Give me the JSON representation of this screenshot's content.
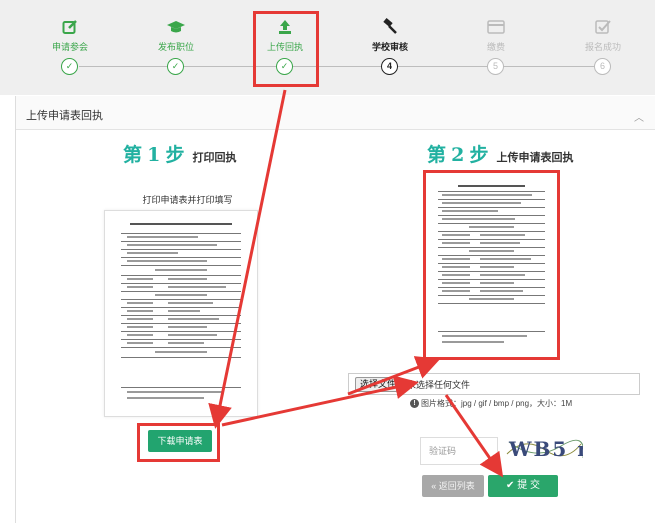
{
  "stepper": {
    "steps": [
      {
        "label": "申请参会",
        "num": "1",
        "state": "done",
        "icon": "edit-icon"
      },
      {
        "label": "发布职位",
        "num": "2",
        "state": "done",
        "icon": "graduation-cap-icon"
      },
      {
        "label": "上传回执",
        "num": "3",
        "state": "done",
        "icon": "upload-icon"
      },
      {
        "label": "学校审核",
        "num": "4",
        "state": "current",
        "icon": "gavel-icon"
      },
      {
        "label": "缴费",
        "num": "5",
        "state": "todo",
        "icon": "credit-card-icon"
      },
      {
        "label": "报名成功",
        "num": "6",
        "state": "todo",
        "icon": "check-square-icon"
      }
    ]
  },
  "panel": {
    "title": "上传申请表回执",
    "collapse_icon": "chevron-up-icon"
  },
  "step1": {
    "prefix": "第",
    "num": "1",
    "suffix": "步",
    "subtitle": "打印回执",
    "hint": "打印申请表并打印填写",
    "download_label": "下载申请表"
  },
  "step2": {
    "prefix": "第",
    "num": "2",
    "suffix": "步",
    "subtitle": "上传申请表回执",
    "choose_file_label": "选择文件",
    "no_file_text": "未选择任何文件",
    "format_hint": "图片格式：jpg / gif / bmp / png，大小：1M",
    "captcha_placeholder": "验证码",
    "captcha_text": "WB5 m",
    "back_label": "« 返回列表",
    "submit_label": "✔ 提 交"
  },
  "colors": {
    "accent": "#22b1a1",
    "done_green": "#3aa64a",
    "button_green": "#22a46f",
    "highlight_red": "#e53935"
  }
}
